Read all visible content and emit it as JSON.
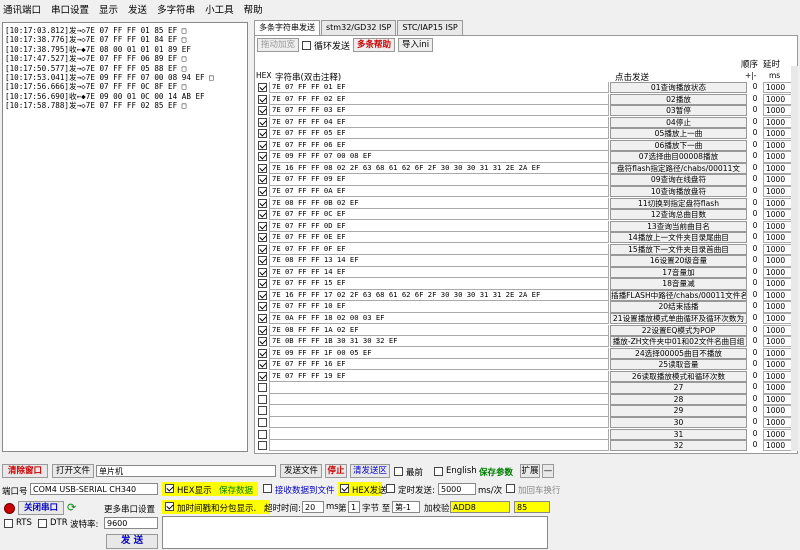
{
  "menu": [
    "通讯端口",
    "串口设置",
    "显示",
    "发送",
    "多字符串",
    "小工具",
    "帮助"
  ],
  "log": [
    "[10:17:03.812]发→◇7E 07 FF FF 01 85 EF □",
    "[10:17:38.776]发→◇7E 07 FF FF 01 84 EF □",
    "[10:17:38.795]收←◆7E 08 00 01 01 01 89 EF",
    "[10:17:47.527]发→◇7E 07 FF FF 06 89 EF □",
    "[10:17:50.577]发→◇7E 07 FF FF 05 88 EF □",
    "[10:17:53.041]发→◇7E 09 FF FF 07 00 08 94 EF □",
    "[10:17:56.666]发→◇7E 07 FF FF 0C 8F EF □",
    "[10:17:56.690]收←◆7E 09 00 01 0C 00 14 AB EF",
    "[10:17:58.788]发→◇7E 07 FF FF 02 85 EF □"
  ],
  "tabs": [
    "多条字符串发送",
    "stm32/GD32 ISP",
    "STC/IAP15 ISP"
  ],
  "toolbar": {
    "drag": "拖动加宽",
    "loop": "循环发送",
    "help": "多条帮助",
    "import": "导入ini"
  },
  "headers": {
    "hex": "HEX",
    "str": "字符串(双击注释)",
    "send": "点击发送",
    "seq": "顺序",
    "delay": "延时",
    "plusminus": "+|-",
    "ms": "ms"
  },
  "rows": [
    {
      "on": true,
      "hex": "7E 07 FF FF 01 EF",
      "label": "01查询播放状态",
      "seq": "0",
      "delay": "1000"
    },
    {
      "on": true,
      "hex": "7E 07 FF FF 02 EF",
      "label": "02播放",
      "seq": "0",
      "delay": "1000"
    },
    {
      "on": true,
      "hex": "7E 07 FF FF 03 EF",
      "label": "03暂停",
      "seq": "0",
      "delay": "1000"
    },
    {
      "on": true,
      "hex": "7E 07 FF FF 04 EF",
      "label": "04停止",
      "seq": "0",
      "delay": "1000"
    },
    {
      "on": true,
      "hex": "7E 07 FF FF 05 EF",
      "label": "05播放上一曲",
      "seq": "0",
      "delay": "1000"
    },
    {
      "on": true,
      "hex": "7E 07 FF FF 06 EF",
      "label": "06播放下一曲",
      "seq": "0",
      "delay": "1000"
    },
    {
      "on": true,
      "hex": "7E 09 FF FF 07 00 08 EF",
      "label": "07选择曲目00008播放",
      "seq": "0",
      "delay": "1000"
    },
    {
      "on": true,
      "hex": "7E 16 FF FF 08 02 2F 63 68 61 62 6F 2F 30 30 30 31 31 2E 2A EF",
      "label": "盘符flash指定路径/chabs/00011文",
      "seq": "0",
      "delay": "1000"
    },
    {
      "on": true,
      "hex": "7E 07 FF FF 09 EF",
      "label": "09查询在线盘符",
      "seq": "0",
      "delay": "1000"
    },
    {
      "on": true,
      "hex": "7E 07 FF FF 0A EF",
      "label": "10查询播放盘符",
      "seq": "0",
      "delay": "1000"
    },
    {
      "on": true,
      "hex": "7E 08 FF FF 0B 02 EF",
      "label": "11切换到指定盘符flash",
      "seq": "0",
      "delay": "1000"
    },
    {
      "on": true,
      "hex": "7E 07 FF FF 0C EF",
      "label": "12查询总曲目数",
      "seq": "0",
      "delay": "1000"
    },
    {
      "on": true,
      "hex": "7E 07 FF FF 0D EF",
      "label": "13查询当前曲目名",
      "seq": "0",
      "delay": "1000"
    },
    {
      "on": true,
      "hex": "7E 07 FF FF 0E EF",
      "label": "14播放上一文件夹目录尾曲目",
      "seq": "0",
      "delay": "1000"
    },
    {
      "on": true,
      "hex": "7E 07 FF FF 0F EF",
      "label": "15播放下一文件夹目录首曲目",
      "seq": "0",
      "delay": "1000"
    },
    {
      "on": true,
      "hex": "7E 08 FF FF 13 14 EF",
      "label": "16设置20级音量",
      "seq": "0",
      "delay": "1000"
    },
    {
      "on": true,
      "hex": "7E 07 FF FF 14 EF",
      "label": "17音量加",
      "seq": "0",
      "delay": "1000"
    },
    {
      "on": true,
      "hex": "7E 07 FF FF 15 EF",
      "label": "18音量减",
      "seq": "0",
      "delay": "1000"
    },
    {
      "on": true,
      "hex": "7E 16 FF FF 17 02 2F 63 68 61 62 6F 2F 30 30 30 31 31 2E 2A EF",
      "label": "插播FLASH中路径/chabs/00011文件名",
      "seq": "0",
      "delay": "1000"
    },
    {
      "on": true,
      "hex": "7E 07 FF FF 10 EF",
      "label": "20结束插播",
      "seq": "0",
      "delay": "1000"
    },
    {
      "on": true,
      "hex": "7E 0A FF FF 18 02 00 03 EF",
      "label": "21设置播放模式单曲循环及循环次数为",
      "seq": "0",
      "delay": "1000"
    },
    {
      "on": true,
      "hex": "7E 08 FF FF 1A 02 EF",
      "label": "22设置EQ模式为POP",
      "seq": "0",
      "delay": "1000"
    },
    {
      "on": true,
      "hex": "7E 0B FF FF 1B 30 31 30 32 EF",
      "label": "播放-ZH文件夹中01和02文件名曲目组",
      "seq": "0",
      "delay": "1000"
    },
    {
      "on": true,
      "hex": "7E 09 FF FF 1F 00 05 EF",
      "label": "24选择00005曲目不播放",
      "seq": "0",
      "delay": "1000"
    },
    {
      "on": true,
      "hex": "7E 07 FF FF 16 EF",
      "label": "25读取音量",
      "seq": "0",
      "delay": "1000"
    },
    {
      "on": true,
      "hex": "7E 07 FF FF 19 EF",
      "label": "26读取播放模式和循环次数",
      "seq": "0",
      "delay": "1000"
    },
    {
      "on": false,
      "hex": "",
      "label": "27",
      "seq": "0",
      "delay": "1000"
    },
    {
      "on": false,
      "hex": "",
      "label": "28",
      "seq": "0",
      "delay": "1000"
    },
    {
      "on": false,
      "hex": "",
      "label": "29",
      "seq": "0",
      "delay": "1000"
    },
    {
      "on": false,
      "hex": "",
      "label": "30",
      "seq": "0",
      "delay": "1000"
    },
    {
      "on": false,
      "hex": "",
      "label": "31",
      "seq": "0",
      "delay": "1000"
    },
    {
      "on": false,
      "hex": "",
      "label": "32",
      "seq": "0",
      "delay": "1000"
    }
  ],
  "bottom": {
    "clear": "清除窗口",
    "openfile": "打开文件",
    "filename": "单片机",
    "sendfile": "发送文件",
    "stop": "停止",
    "clearsend": "清发送区",
    "top": "最前",
    "english": "English",
    "saveparam": "保存参数",
    "expand": "扩展",
    "dash": "—",
    "port_label": "端口号",
    "port_value": "COM4 USB-SERIAL CH340",
    "hexshow": "HEX显示",
    "savedata": "保存数据",
    "recvfile": "接收数据到文件",
    "hexsend": "HEX发送",
    "timed": "定时发送:",
    "interval": "5000",
    "interval_unit": "ms/次",
    "crlf": "加回车换行",
    "close_port": "关闭串口",
    "multi": "更多串口设置",
    "timestamp": "加时间戳和分包显示.",
    "timeout_label": "超时时间:",
    "timeout": "20",
    "ms": "ms",
    "nth": "第",
    "n1": "1",
    "byte_label": "字节 至",
    "to_value": "第-1",
    "checksum_label": "加校验",
    "checksum_value": "ADD8",
    "result": "85",
    "rts": "RTS",
    "dtr": "DTR",
    "baud_label": "波特率:",
    "baud": "9600",
    "send": "发 送"
  }
}
